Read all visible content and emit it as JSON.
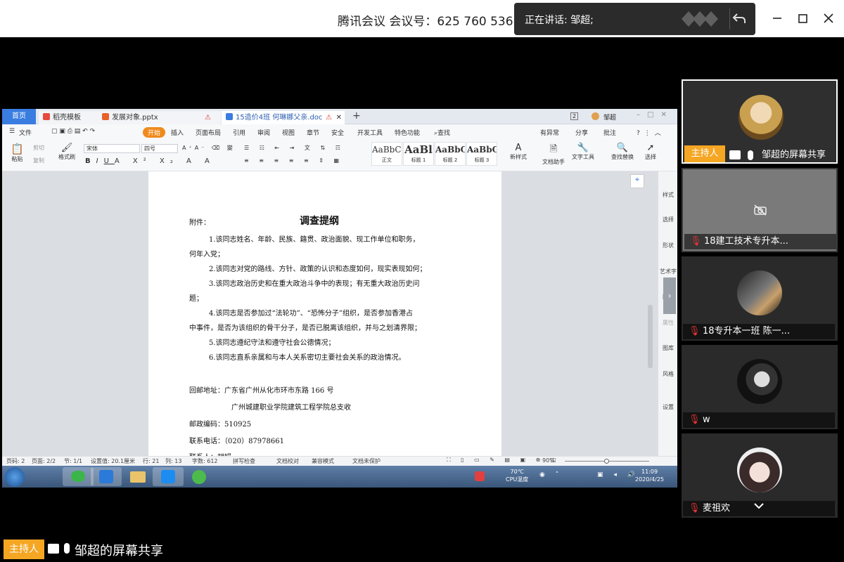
{
  "meeting": {
    "title": "腾讯会议 会议号：625 760 536",
    "speaking": "正在讲话: 邹超;"
  },
  "tabs": {
    "home": "首页",
    "t1": "稻壳模板",
    "t2": "发展对象.pptx",
    "t3": "15造价4班 何琳娜父亲.doc",
    "count": "2",
    "user": "邹超"
  },
  "menus": [
    "文件",
    "开始",
    "插入",
    "页面布局",
    "引用",
    "审阅",
    "视图",
    "章节",
    "安全",
    "开发工具",
    "特色功能",
    "查找"
  ],
  "menu_right": {
    "sync": "有异常",
    "share": "分享",
    "annotate": "批注"
  },
  "ribbon": {
    "paste": "粘贴",
    "cut": "剪切",
    "copy": "复制",
    "painter": "格式刷",
    "font": "宋体",
    "size": "四号",
    "styles": [
      {
        "sample": "AaBbCcDd",
        "name": "正文"
      },
      {
        "sample": "AaBl",
        "name": "标题 1"
      },
      {
        "sample": "AaBbC",
        "name": "标题 2"
      },
      {
        "sample": "AaBbC",
        "name": "标题 3"
      }
    ],
    "newstyle": "新样式",
    "assistant": "文档助手",
    "tools": "文字工具",
    "replace": "查找替换",
    "select": "选择"
  },
  "doc": {
    "label": "附件：",
    "heading": "调查提纲",
    "p1a": "1.该同志姓名、年龄、民族、籍贯、政治面貌、现工作单位和职务，",
    "p1b": "何年入党；",
    "p2": "2.该同志对党的路线、方针、政策的认识和态度如何，现实表现如何；",
    "p3a": "3.该同志政治历史和在重大政治斗争中的表现；有无重大政治历史问",
    "p3b": "题；",
    "p4a": "4.该同志是否参加过“法轮功”、“恐怖分子”组织，是否参加香港占",
    "p4b": "中事件，是否为该组织的骨干分子，是否已脱离该组织，并与之划清界限；",
    "p5": "5.该同志遵纪守法和遵守社会公德情况；",
    "p6": "6.该同志直系亲属和与本人关系密切主要社会关系的政治情况。",
    "addr1": "回邮地址：广东省广州从化市环市东路 166 号",
    "addr2": "广州城建职业学院建筑工程学院总支收",
    "zip": "邮政编码：510925",
    "phone": "联系电话：（020）87978661",
    "contact": "联系人：胡娟"
  },
  "side": [
    "样式",
    "选择",
    "形状",
    "艺术字",
    "图表",
    "属性",
    "图库",
    "风格",
    "设置"
  ],
  "status": {
    "page": "页码: 2",
    "pages": "页面: 2/2",
    "section": "节: 1/1",
    "setting": "设置值: 20.1厘米",
    "row": "行: 21",
    "col": "列: 13",
    "words": "字数: 612",
    "spell": "拼写检查",
    "proof": "文档校对",
    "compat": "兼容模式",
    "protect": "文档未保护",
    "zoom": "90%"
  },
  "taskbar": {
    "temp": "70℃",
    "cpu": "CPU温度",
    "time": "11:09",
    "date": "2020/4/25"
  },
  "participants": [
    {
      "name": "邹超的屏幕共享",
      "host": "主持人"
    },
    {
      "name": "18建工技术专升本..."
    },
    {
      "name": "18专升本一班 陈一..."
    },
    {
      "name": "w"
    },
    {
      "name": "麦祖欢"
    }
  ],
  "bottom": {
    "host": "主持人",
    "label": "邹超的屏幕共享"
  }
}
